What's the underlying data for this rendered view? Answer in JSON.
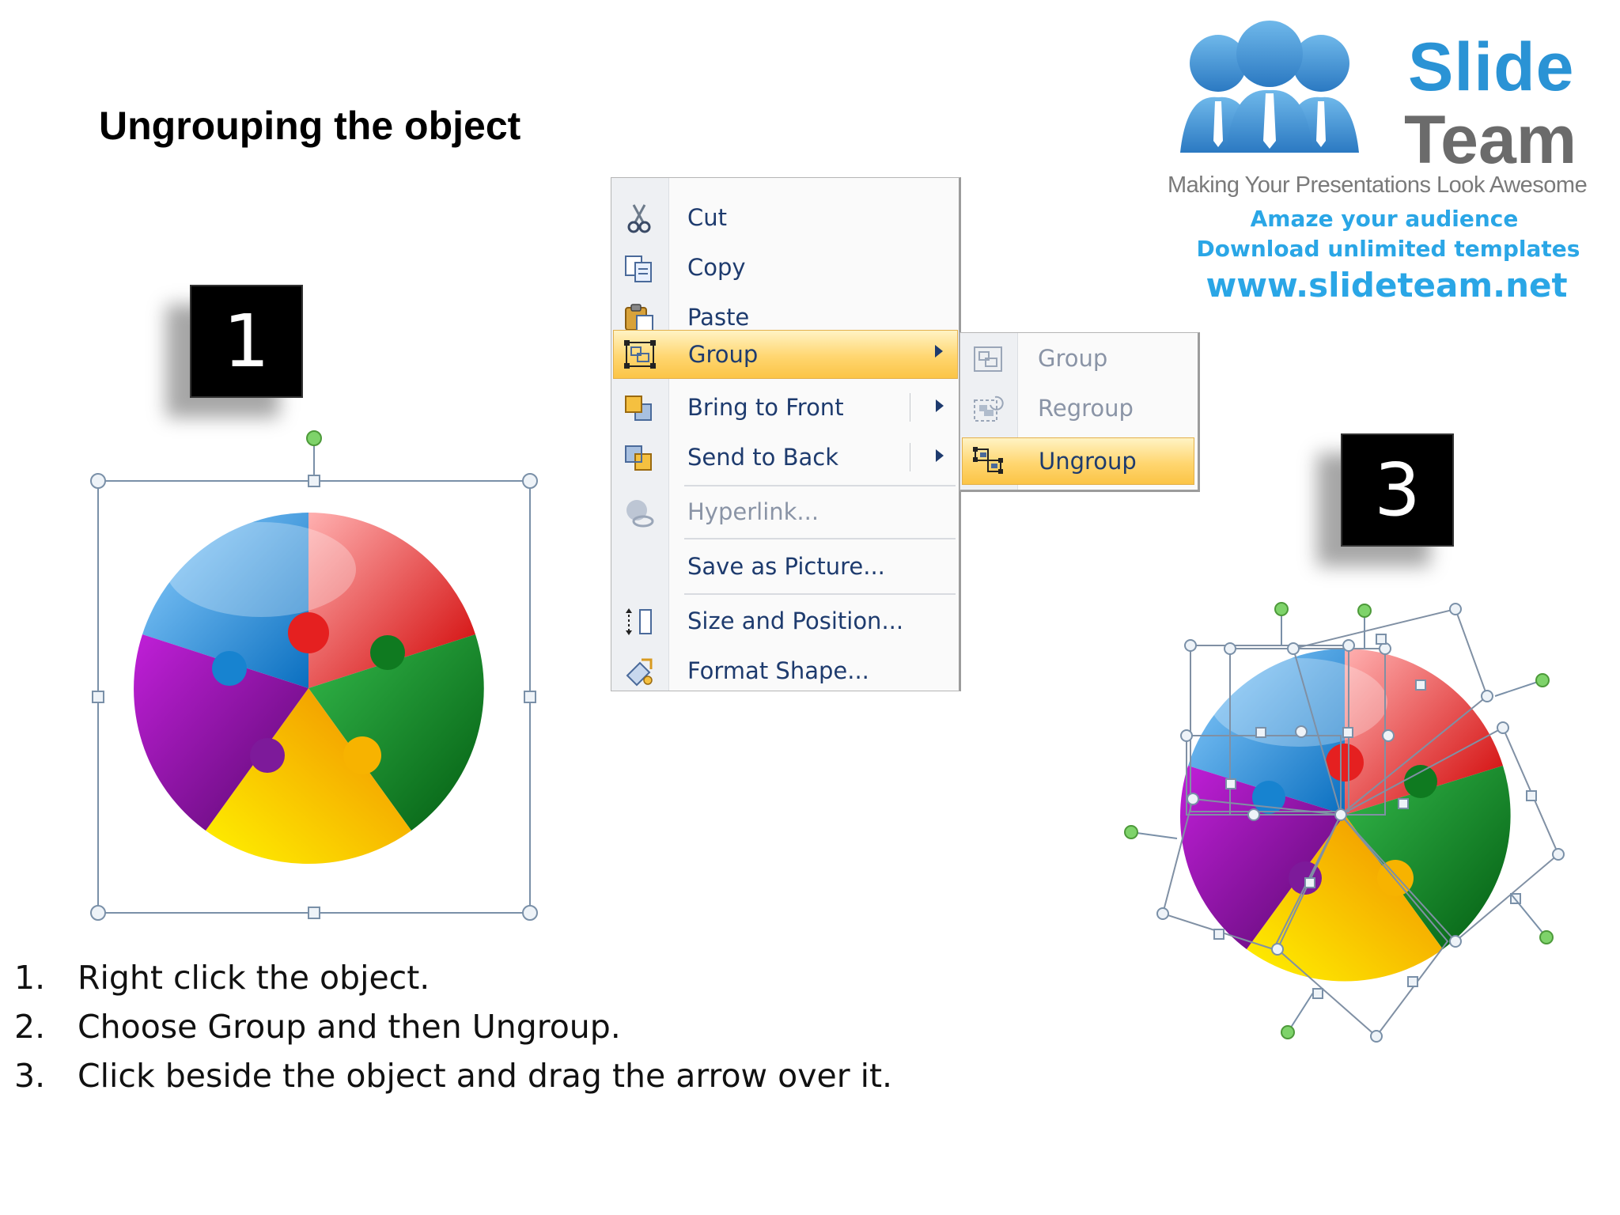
{
  "slide": {
    "title": "Ungrouping the object"
  },
  "logo": {
    "word1": "Slide",
    "word2": "Team",
    "tagline": "Making Your Presentations Look Awesome",
    "line1": "Amaze your audience",
    "line2": "Download unlimited templates",
    "url": "www.slideteam.net"
  },
  "badges": {
    "step1": "1",
    "step3": "3"
  },
  "context_menu": {
    "items": [
      {
        "label": "Cut",
        "icon": "scissors-icon"
      },
      {
        "label": "Copy",
        "icon": "copy-icon"
      },
      {
        "label": "Paste",
        "icon": "paste-icon"
      },
      {
        "label": "Group",
        "icon": "group-icon",
        "highlighted": true,
        "submenu": true
      },
      {
        "label": "Bring to Front",
        "icon": "bring-to-front-icon",
        "submenu": true
      },
      {
        "label": "Send to Back",
        "icon": "send-to-back-icon",
        "submenu": true
      },
      {
        "label": "Hyperlink...",
        "icon": "hyperlink-icon",
        "disabled": true
      },
      {
        "label": "Save as Picture...",
        "icon": ""
      },
      {
        "label": "Size and Position...",
        "icon": "size-position-icon"
      },
      {
        "label": "Format Shape...",
        "icon": "format-shape-icon"
      }
    ]
  },
  "submenu": {
    "items": [
      {
        "label": "Group",
        "icon": "group-icon",
        "disabled": true
      },
      {
        "label": "Regroup",
        "icon": "regroup-icon",
        "disabled": true
      },
      {
        "label": "Ungroup",
        "icon": "ungroup-icon",
        "highlighted": true
      }
    ]
  },
  "instructions": [
    {
      "num": "1.",
      "text": "Right click the object."
    },
    {
      "num": "2.",
      "text": "Choose Group and then Ungroup."
    },
    {
      "num": "3.",
      "text": "Click beside the object and drag the arrow over it."
    }
  ],
  "colors": {
    "puzzle_blue": "#1a8fd8",
    "puzzle_red": "#e01010",
    "puzzle_green": "#0d7a1c",
    "puzzle_yellow": "#f5b800",
    "puzzle_purple": "#7a1a9a",
    "menu_highlight": "#ffd670",
    "menu_text": "#1e3b6e",
    "brand_blue": "#2a93d5"
  }
}
